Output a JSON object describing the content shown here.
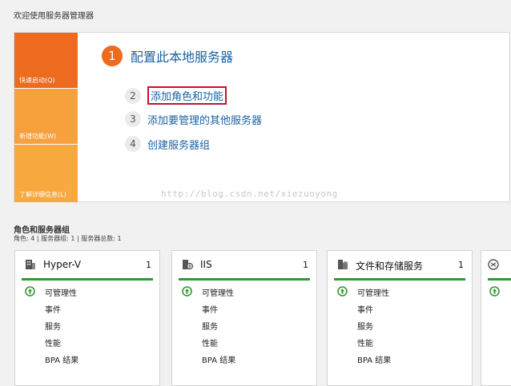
{
  "welcome": {
    "title": "欢迎使用服务器管理器",
    "tiles": [
      "快速启动(Q)",
      "新增功能(W)",
      "了解详细信息(L)"
    ],
    "steps": [
      {
        "num": "1",
        "label": "配置此本地服务器"
      },
      {
        "num": "2",
        "label": "添加角色和功能"
      },
      {
        "num": "3",
        "label": "添加要管理的其他服务器"
      },
      {
        "num": "4",
        "label": "创建服务器组"
      }
    ]
  },
  "watermark": "http://blog.csdn.net/xiezuoyong",
  "roles": {
    "title": "角色和服务器组",
    "summary": "角色: 4 | 服务器组: 1 | 服务器总数: 1",
    "cards": [
      {
        "title": "Hyper-V",
        "count": "1",
        "rows": [
          "可管理性",
          "事件",
          "服务",
          "性能",
          "BPA 结果"
        ]
      },
      {
        "title": "IIS",
        "count": "1",
        "rows": [
          "可管理性",
          "事件",
          "服务",
          "性能",
          "BPA 结果"
        ]
      },
      {
        "title": "文件和存储服务",
        "count": "1",
        "rows": [
          "可管理性",
          "事件",
          "服务",
          "性能",
          "BPA 结果"
        ]
      }
    ]
  },
  "colors": {
    "accent_orange": "#ed6b1f",
    "tile_light": "#f6a03e",
    "link_blue": "#1a63a3",
    "status_green": "#2f9a2f",
    "highlight_red": "#c8102e"
  },
  "icons": {
    "card_1": "hyperv-icon",
    "card_2": "iis-icon",
    "card_3": "file-storage-icon",
    "card_4": "network-icon",
    "status": "up-arrow-circle-icon"
  }
}
